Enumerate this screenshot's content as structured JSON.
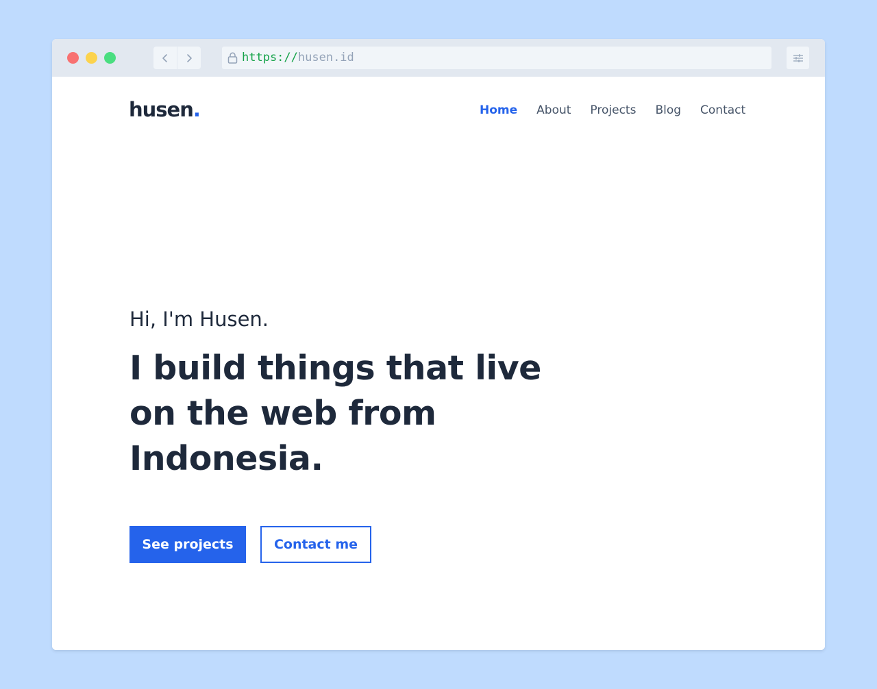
{
  "browser": {
    "url_scheme": "https://",
    "url_host": "husen.id",
    "icons": {
      "back": "chevron-left-icon",
      "forward": "chevron-right-icon",
      "secure": "lock-icon",
      "menu": "sliders-icon"
    },
    "traffic_lights": [
      "#f87171",
      "#fcd34d",
      "#4ade80"
    ]
  },
  "header": {
    "logo_text": "husen",
    "logo_dot": ".",
    "nav": [
      {
        "label": "Home",
        "active": true
      },
      {
        "label": "About",
        "active": false
      },
      {
        "label": "Projects",
        "active": false
      },
      {
        "label": "Blog",
        "active": false
      },
      {
        "label": "Contact",
        "active": false
      }
    ]
  },
  "hero": {
    "greeting": "Hi, I'm Husen.",
    "headline": "I build things that live on the web from Indonesia.",
    "primary_cta": "See projects",
    "secondary_cta": "Contact me"
  },
  "colors": {
    "background": "#bfdbfe",
    "accent": "#2563eb",
    "text": "#1e293b",
    "nav_text": "#475569",
    "chrome": "#e2e8f0"
  }
}
